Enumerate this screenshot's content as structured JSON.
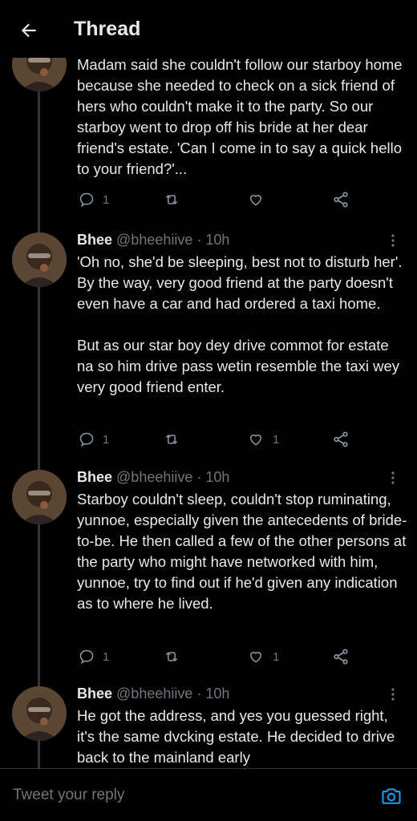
{
  "header": {
    "title": "Thread"
  },
  "tweets": [
    {
      "name": "",
      "handle": "",
      "dot": "",
      "time": "",
      "text": "Madam said she couldn't follow our starboy home because she needed to check on a sick friend of hers who couldn't make it to the party. So our starboy went to drop off his bride at her dear friend's estate. 'Can I come in to say a quick hello to your friend?'...",
      "replies": "1",
      "likes": ""
    },
    {
      "name": "Bhee",
      "handle": "@bheehiive",
      "dot": "·",
      "time": "10h",
      "text": "'Oh no, she'd be sleeping, best not to disturb her'.    By the way, very good friend at the party doesn't even have a car and had ordered a taxi home.\n\nBut as our star boy dey drive commot for estate na so him drive pass wetin resemble the taxi wey very good friend enter.",
      "replies": "1",
      "likes": "1"
    },
    {
      "name": "Bhee",
      "handle": "@bheehiive",
      "dot": "·",
      "time": "10h",
      "text": "Starboy couldn't sleep, couldn't stop ruminating, yunnoe, especially given the antecedents of bride-to-be. He then called a few of the other persons at the party who might have networked with him, yunnoe, try to find out if he'd given any indication as to where he lived.",
      "replies": "1",
      "likes": "1"
    },
    {
      "name": "Bhee",
      "handle": "@bheehiive",
      "dot": "·",
      "time": "10h",
      "text": "He got the address, and yes you guessed right, it's the same dvcking estate. He decided to drive back to the mainland early",
      "replies": "",
      "likes": ""
    }
  ],
  "reply_bar": {
    "placeholder": "Tweet your reply"
  },
  "icons": {
    "back": "arrow-left-icon",
    "reply": "reply-icon",
    "retweet": "retweet-icon",
    "like": "heart-icon",
    "share": "share-icon",
    "more": "more-vertical-icon",
    "camera": "camera-icon"
  },
  "colors": {
    "background": "#000000",
    "text": "#e7e9ea",
    "muted": "#71767b",
    "accent": "#1d9bf0"
  }
}
